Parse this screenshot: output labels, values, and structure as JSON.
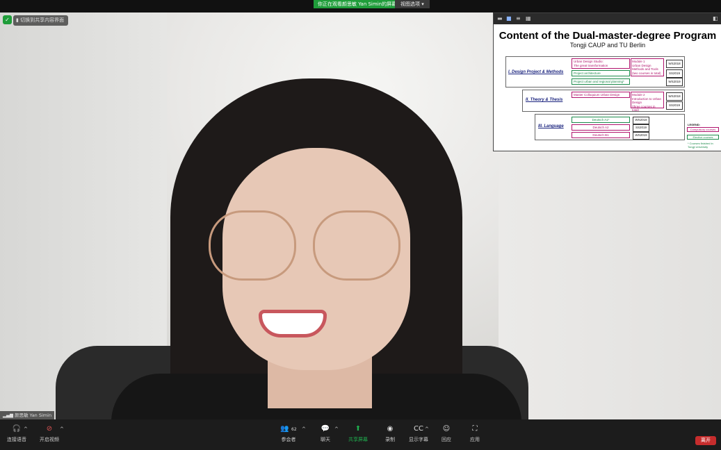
{
  "banner": {
    "sharing_text": "你正在观看颜思敏 Yan Simin的屏幕",
    "view_options": "视图选项 ▾"
  },
  "video": {
    "switch_label": "切换到共享内容界面",
    "participant_name": "颜思敏 Yan Simin"
  },
  "slide": {
    "title": "Content of the Dual-master-degree Program",
    "subtitle": "Tongji CAUP and TU Berlin",
    "sections": {
      "design": "I. Design Project & Methods",
      "theory": "II. Theory & Thesis",
      "language": "III. Language"
    },
    "courses": {
      "uds": "Urban Design Studio:\nThe great transformation",
      "arch": "Project architecture",
      "plan": "Project urban and regional planning*",
      "collo": "Master Colloquium Urban Design",
      "de1": "Deutsch A1*",
      "de2": "Deutsch A2",
      "de3": "Deutsch B1"
    },
    "modules": {
      "m1": "Module 1\nUrban Design\nMethods and Tools\n(two courses in total)",
      "m2": "Module 2\nIntroduction to Urban\nDesign\n(three courses in total)"
    },
    "semesters": {
      "s1": "WS2018",
      "s2": "SS2019",
      "s3": "WS2019",
      "s4": "WS2018",
      "s5": "SS2019",
      "s6": "WS2018",
      "s7": "SS2019",
      "s8": "WS2019"
    },
    "legend": {
      "title": "LEGEND:",
      "compulsory": "Compulsory courses",
      "elective": "Elective courses",
      "note": "* Courses finished in\nTongji University"
    },
    "colors": {
      "compulsory": "#b0126c",
      "elective": "#1c8a4a"
    }
  },
  "toolbar": {
    "audio": "连接语音",
    "video": "开启视频",
    "participants": "参会者",
    "participants_count": "62",
    "chat": "聊天",
    "share": "共享屏幕",
    "record": "录制",
    "captions": "显示字幕",
    "reactions": "回应",
    "apps": "应用",
    "leave": "离开"
  }
}
